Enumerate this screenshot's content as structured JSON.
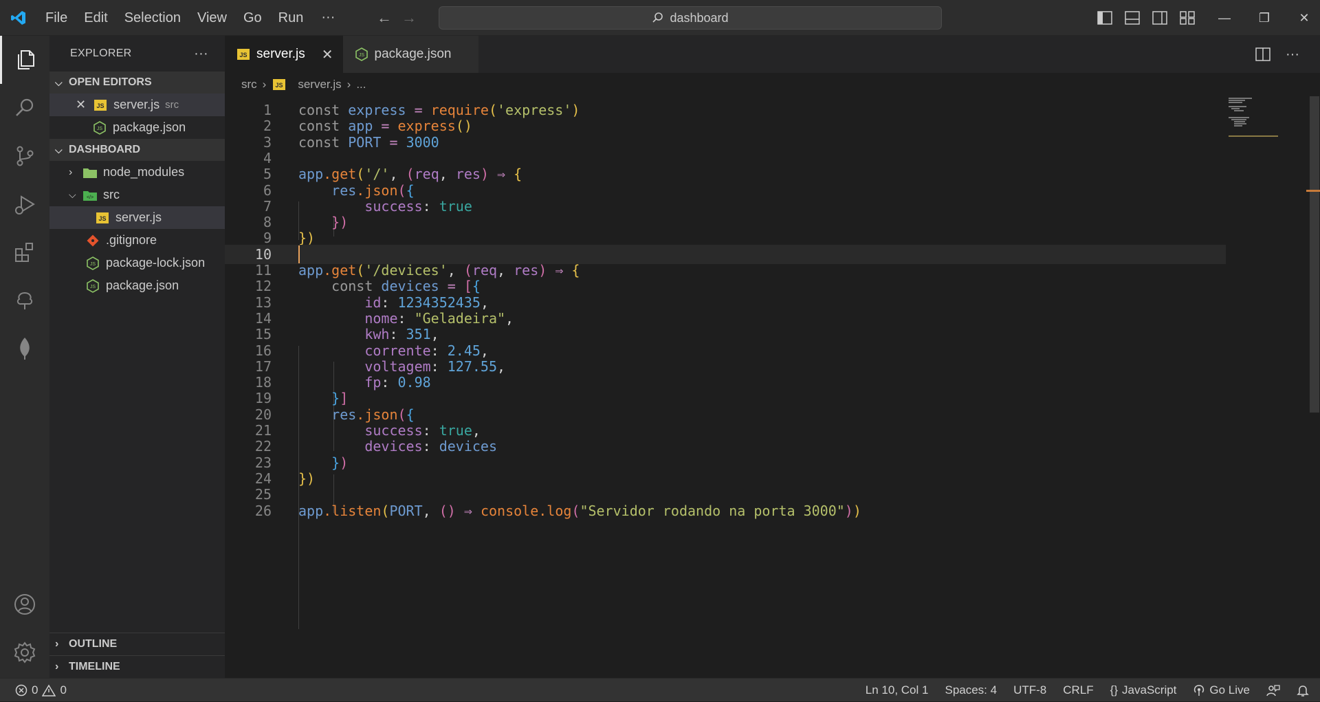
{
  "titlebar": {
    "menu": [
      "File",
      "Edit",
      "Selection",
      "View",
      "Go",
      "Run"
    ],
    "more": "···",
    "search": "dashboard"
  },
  "sidebar": {
    "title": "EXPLORER",
    "more": "···",
    "open_editors_label": "OPEN EDITORS",
    "open_editors": [
      {
        "name": "server.js",
        "desc": "src",
        "icon": "js"
      },
      {
        "name": "package.json",
        "icon": "node"
      }
    ],
    "project_label": "DASHBOARD",
    "tree": [
      {
        "name": "node_modules"
      },
      {
        "name": "src"
      },
      {
        "name": "server.js"
      },
      {
        "name": ".gitignore"
      },
      {
        "name": "package-lock.json"
      },
      {
        "name": "package.json"
      }
    ],
    "outline_label": "OUTLINE",
    "timeline_label": "TIMELINE"
  },
  "tabs": [
    {
      "name": "server.js",
      "icon": "js",
      "active": true,
      "close": "✕"
    },
    {
      "name": "package.json",
      "icon": "node",
      "active": false
    }
  ],
  "breadcrumb": {
    "folder": "src",
    "file": "server.js",
    "rest": "..."
  },
  "editor": {
    "current_line": 10,
    "lines": [
      [
        [
          "kw",
          "const "
        ],
        [
          "v",
          "express "
        ],
        [
          "op",
          "= "
        ],
        [
          "fn",
          "require"
        ],
        [
          "b1",
          "("
        ],
        [
          "s",
          "'express'"
        ],
        [
          "b1",
          ")"
        ]
      ],
      [
        [
          "kw",
          "const "
        ],
        [
          "v",
          "app "
        ],
        [
          "op",
          "= "
        ],
        [
          "fn",
          "express"
        ],
        [
          "b1",
          "()"
        ]
      ],
      [
        [
          "kw",
          "const "
        ],
        [
          "v",
          "PORT "
        ],
        [
          "op",
          "= "
        ],
        [
          "n",
          "3000"
        ]
      ],
      [],
      [
        [
          "v",
          "app"
        ],
        [
          "",
          ""
        ],
        [
          "fn",
          ".get"
        ],
        [
          "b1",
          "("
        ],
        [
          "s",
          "'/'"
        ],
        [
          "",
          ", "
        ],
        [
          "b2",
          "("
        ],
        [
          "pr",
          "req"
        ],
        [
          "",
          ", "
        ],
        [
          "pr",
          "res"
        ],
        [
          "b2",
          ")"
        ],
        [
          "op",
          " ⇒ "
        ],
        [
          "b1",
          "{"
        ]
      ],
      [
        [
          "",
          ""
        ],
        [
          "v",
          "    res"
        ],
        [
          "fn",
          ".json"
        ],
        [
          "b2",
          "("
        ],
        [
          "b3",
          "{"
        ]
      ],
      [
        [
          "pr",
          "        success"
        ],
        [
          "",
          ": "
        ],
        [
          "t",
          "true"
        ]
      ],
      [
        [
          "b2",
          "    })"
        ]
      ],
      [
        [
          "b1",
          "})"
        ]
      ],
      [],
      [
        [
          "v",
          "app"
        ],
        [
          "fn",
          ".get"
        ],
        [
          "b1",
          "("
        ],
        [
          "s",
          "'/devices'"
        ],
        [
          "",
          ", "
        ],
        [
          "b2",
          "("
        ],
        [
          "pr",
          "req"
        ],
        [
          "",
          ", "
        ],
        [
          "pr",
          "res"
        ],
        [
          "b2",
          ")"
        ],
        [
          "op",
          " ⇒ "
        ],
        [
          "b1",
          "{"
        ]
      ],
      [
        [
          "kw",
          "    const "
        ],
        [
          "v",
          "devices "
        ],
        [
          "op",
          "= "
        ],
        [
          "b2",
          "["
        ],
        [
          "b3",
          "{"
        ]
      ],
      [
        [
          "pr",
          "        id"
        ],
        [
          "",
          ": "
        ],
        [
          "n",
          "1234352435"
        ],
        [
          "",
          ","
        ]
      ],
      [
        [
          "pr",
          "        nome"
        ],
        [
          "",
          ": "
        ],
        [
          "s",
          "\"Geladeira\""
        ],
        [
          "",
          ","
        ]
      ],
      [
        [
          "pr",
          "        kwh"
        ],
        [
          "",
          ": "
        ],
        [
          "n",
          "351"
        ],
        [
          "",
          ","
        ]
      ],
      [
        [
          "pr",
          "        corrente"
        ],
        [
          "",
          ": "
        ],
        [
          "n",
          "2.45"
        ],
        [
          "",
          ","
        ]
      ],
      [
        [
          "pr",
          "        voltagem"
        ],
        [
          "",
          ": "
        ],
        [
          "n",
          "127.55"
        ],
        [
          "",
          ","
        ]
      ],
      [
        [
          "pr",
          "        fp"
        ],
        [
          "",
          ": "
        ],
        [
          "n",
          "0.98"
        ]
      ],
      [
        [
          "b3",
          "    }"
        ],
        [
          "b2",
          "]"
        ]
      ],
      [
        [
          "v",
          "    res"
        ],
        [
          "fn",
          ".json"
        ],
        [
          "b2",
          "("
        ],
        [
          "b3",
          "{"
        ]
      ],
      [
        [
          "pr",
          "        success"
        ],
        [
          "",
          ": "
        ],
        [
          "t",
          "true"
        ],
        [
          "",
          ","
        ]
      ],
      [
        [
          "pr",
          "        devices"
        ],
        [
          "",
          ": "
        ],
        [
          "v",
          "devices"
        ]
      ],
      [
        [
          "b3",
          "    }"
        ],
        [
          "b2",
          ")"
        ]
      ],
      [
        [
          "b1",
          "})"
        ]
      ],
      [],
      [
        [
          "v",
          "app"
        ],
        [
          "fn",
          ".listen"
        ],
        [
          "b1",
          "("
        ],
        [
          "v",
          "PORT"
        ],
        [
          "",
          ", "
        ],
        [
          "b2",
          "()"
        ],
        [
          "op",
          " ⇒ "
        ],
        [
          "fn",
          "console"
        ],
        [
          "fn",
          ".log"
        ],
        [
          "b2",
          "("
        ],
        [
          "s",
          "\"Servidor rodando na porta 3000\""
        ],
        [
          "b2",
          ")"
        ],
        [
          "b1",
          ")"
        ]
      ]
    ]
  },
  "status": {
    "errors": "0",
    "warnings": "0",
    "position": "Ln 10, Col 1",
    "spaces": "Spaces: 4",
    "encoding": "UTF-8",
    "eol": "CRLF",
    "language": "JavaScript",
    "language_icon": "{}",
    "golive": "Go Live"
  },
  "colors": {
    "accent": "#0078d4",
    "cursor": "#e8a25c",
    "js_badge": "#e8c334",
    "node_green": "#8cc265"
  }
}
